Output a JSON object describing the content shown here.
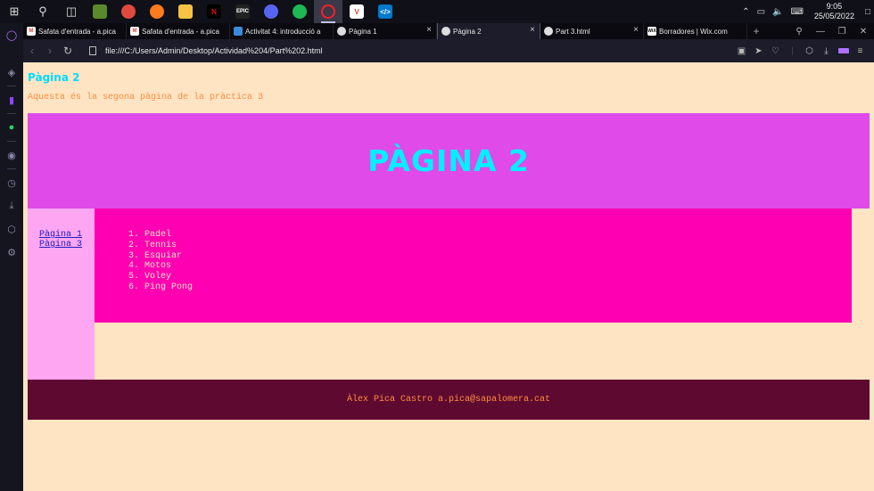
{
  "taskbar": {
    "icons": [
      "windows-icon",
      "search-icon",
      "task-view-icon",
      "minecraft-icon",
      "chrome-icon",
      "firefox-icon",
      "file-explorer-icon",
      "netflix-icon",
      "epic-games-icon",
      "discord-icon",
      "spotify-icon",
      "opera-icon",
      "vivaldi-icon",
      "vscode-icon"
    ],
    "time": "9:05",
    "date": "25/05/2022"
  },
  "tabs": [
    {
      "label": "Safata d'entrada - a.pica",
      "fav_color": "#ea4335",
      "fav_text": "M"
    },
    {
      "label": "Safata d'entrada - a.pica",
      "fav_color": "#ea4335",
      "fav_text": "M"
    },
    {
      "label": "Activitat 4: introducció a",
      "fav_color": "#3b8bdc",
      "fav_text": ""
    },
    {
      "label": "Pàgina 1",
      "fav_color": "#dddddd",
      "fav_text": ""
    },
    {
      "label": "Pàgina 2",
      "fav_color": "#dddddd",
      "fav_text": ""
    },
    {
      "label": "Part 3.html",
      "fav_color": "#dddddd",
      "fav_text": ""
    },
    {
      "label": "Borradores | Wix.com",
      "fav_color": "#ffffff",
      "fav_text": "WiX"
    }
  ],
  "address": {
    "url": "file:///C:/Users/Admin/Desktop/Actividad%204/Part%202.html"
  },
  "page": {
    "heading": "Pàgina 2",
    "intro": "Aquesta és la segona pàgina de la pràctica 3",
    "banner_title": "PÀGINA 2",
    "nav_links": [
      "Pàgina 1",
      "Pàgina 3"
    ],
    "sports": [
      "1. Padel",
      "2. Tennis",
      "3. Esquiar",
      "4. Motos",
      "5. Voley",
      "6. Ping Pong"
    ],
    "footer": "Àlex Pica Castro a.pica@sapalomera.cat"
  },
  "colors": {
    "page_bg": "#ffe4c4",
    "heading": "#00dcff",
    "intro": "#ff8c3c",
    "banner_bg": "#df4ae9",
    "banner_text": "#00f0ff",
    "nav_bg": "#ffa6f3",
    "content_bg": "#fe00b1",
    "footer_bg": "#5e0a30"
  }
}
